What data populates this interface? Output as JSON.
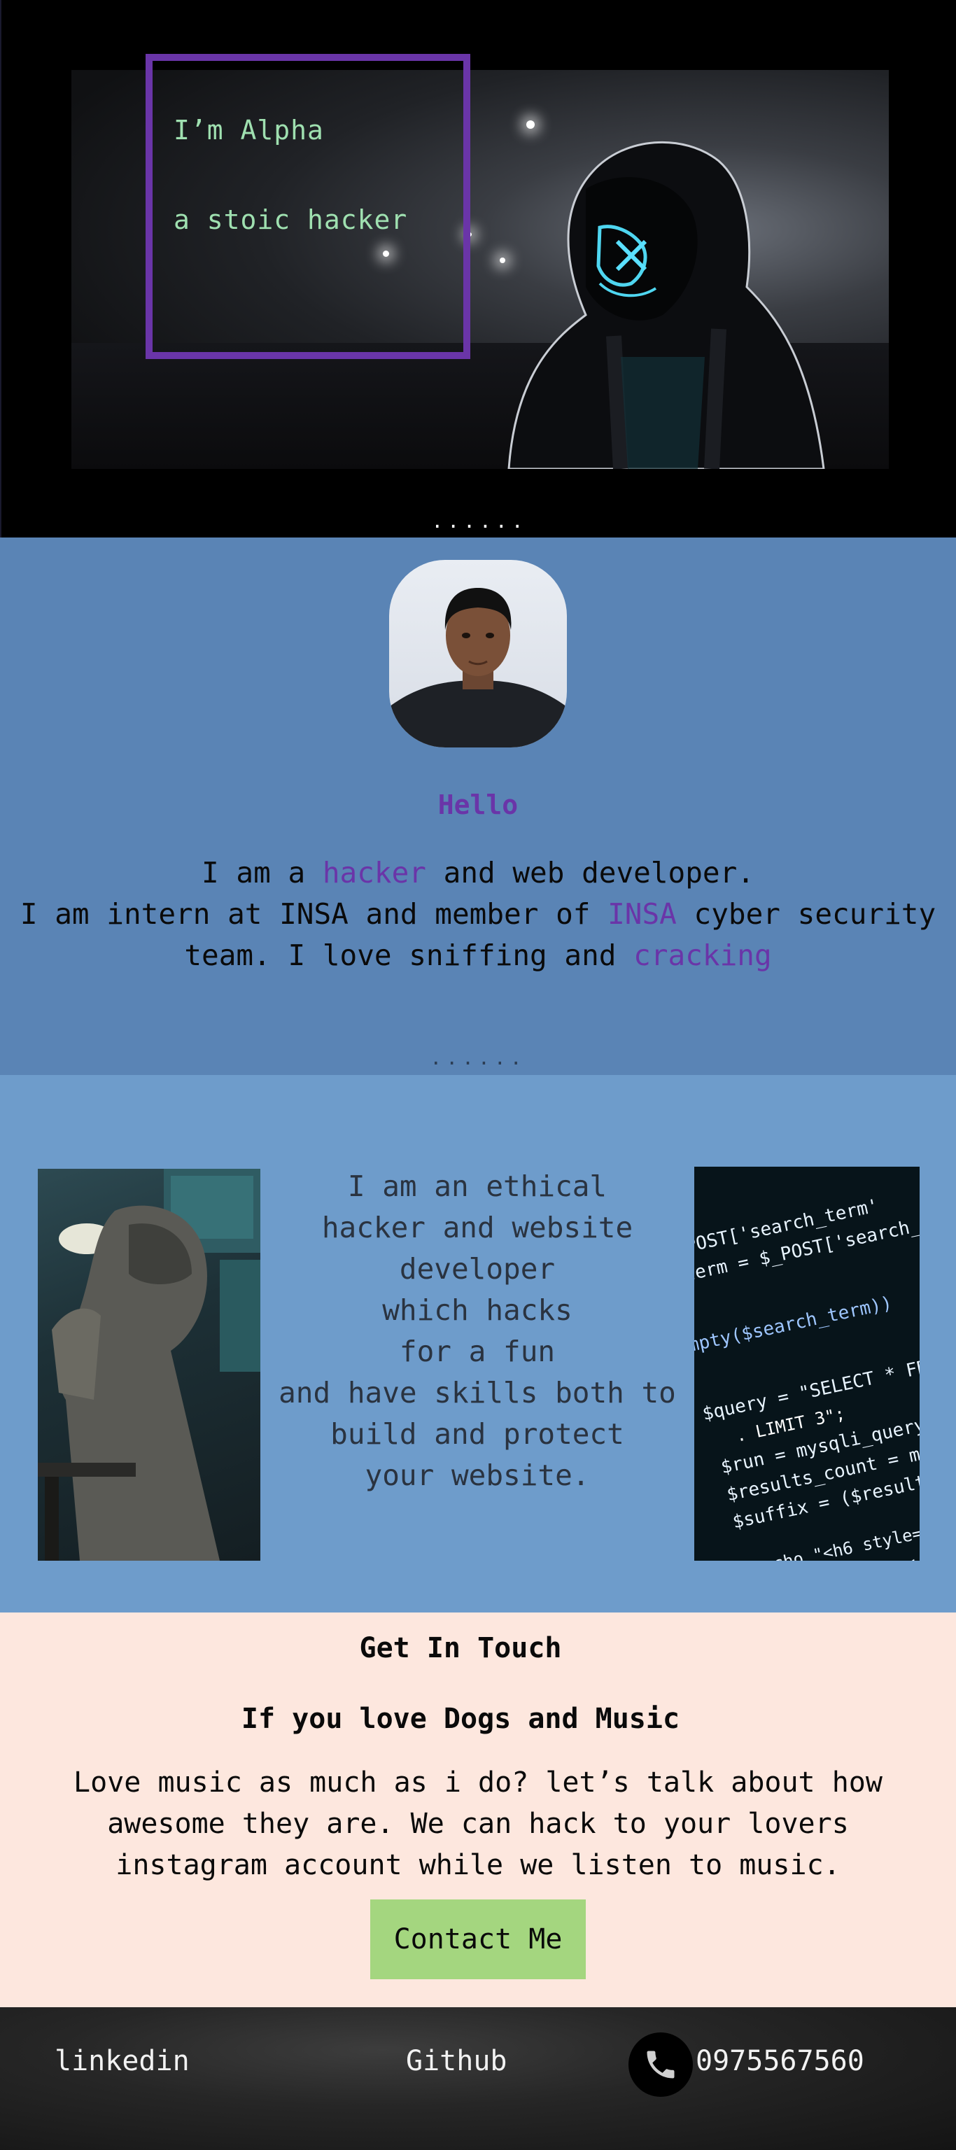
{
  "hero": {
    "greeting": "I’m  Alpha",
    "tagline": "a stoic hacker",
    "dots": "......"
  },
  "about": {
    "hello": "Hello",
    "line1_pre": "I am a ",
    "line1_hl": "hacker",
    "line1_post": " and web developer.",
    "line2_pre": "I am intern at INSA and member of ",
    "line2_hl": "INSA",
    "line2_post": " cyber security",
    "line3_pre": "team. I love sniffing and ",
    "line3_hl": "cracking",
    "dots": "......"
  },
  "skills": {
    "text": "I am an ethical\nhacker and website\ndeveloper\nwhich hacks\nfor a fun\nand have skills both to\nbuild and protect\nyour website."
  },
  "contact": {
    "title": "Get In Touch",
    "subtitle": "If you love Dogs and Music",
    "body": "Love music as much as i do? let’s talk about how awesome they are. We can hack to your lovers instagram account while we listen to music.",
    "button": "Contact Me"
  },
  "footer": {
    "linkedin": "linkedin",
    "github": "Github",
    "phone": "0975567560",
    "phone_icon": "phone-icon"
  },
  "colors": {
    "accent_purple": "#6a35a8",
    "hero_text": "#9fe0b0",
    "about_bg": "#5a84b5",
    "skills_bg": "#6e9ccb",
    "contact_bg": "#fde7de",
    "button_bg": "#a4d67f"
  }
}
